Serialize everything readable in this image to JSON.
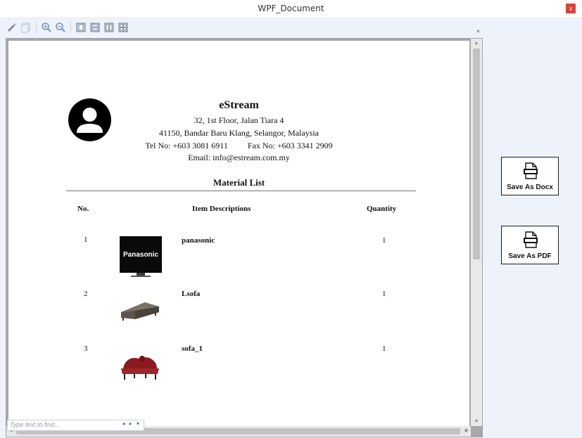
{
  "window": {
    "title": "WPF_Document",
    "close_glyph": "x"
  },
  "toolbar": {
    "icons": [
      "print-icon",
      "copy-icon",
      "zoom-in-icon",
      "zoom-out-icon",
      "single-page-icon",
      "page-width-icon",
      "two-pages-icon",
      "four-pages-icon"
    ]
  },
  "find": {
    "placeholder": "Type text to find...",
    "nav": "◂ ▸ ▾"
  },
  "document": {
    "company": {
      "name": "eStream",
      "address1": "32, 1st Floor, Jalan Tiara 4",
      "address2": "41150, Bandar Baru Klang, Selangor, Malaysia",
      "tel": "Tel No: +603 3081 6911",
      "fax": "Fax No: +603 3341 2909",
      "email": "Email: info@estream.com.my"
    },
    "title": "Material List",
    "columns": {
      "no": "No.",
      "desc": "Item Descriptions",
      "qty": "Quantity"
    },
    "rows": [
      {
        "no": "1",
        "name": "panasonic",
        "qty": "1",
        "image": "panasonic-tv-image",
        "image_label": "Panasonic"
      },
      {
        "no": "2",
        "name": "Lsofa",
        "qty": "1",
        "image": "l-sofa-image"
      },
      {
        "no": "3",
        "name": "sofa_1",
        "qty": "1",
        "image": "red-sofa-image"
      }
    ]
  },
  "actions": {
    "save_docx": "Save As Docx",
    "save_pdf": "Save As PDF"
  }
}
